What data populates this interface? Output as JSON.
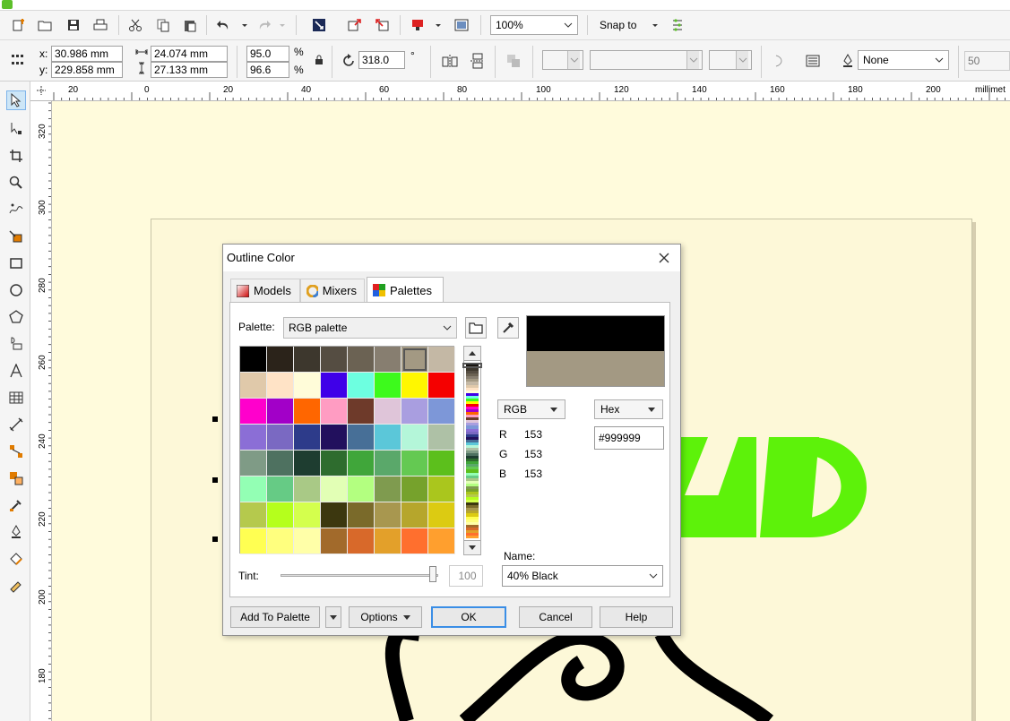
{
  "toolbar": {
    "zoom_value": "100%",
    "snap_label": "Snap to"
  },
  "props": {
    "x_label": "x:",
    "x_value": "30.986 mm",
    "y_label": "y:",
    "y_value": "229.858 mm",
    "width_value": "24.074 mm",
    "height_value": "27.133 mm",
    "scale_x": "95.0",
    "scale_y": "96.6",
    "percent": "%",
    "rotation": "318.0",
    "degree": "°",
    "outline_value": "None",
    "outline_width": "50"
  },
  "ruler": {
    "h_labels": [
      "20",
      "0",
      "20",
      "40",
      "60",
      "80",
      "100",
      "120",
      "140",
      "160",
      "180",
      "200",
      "millimet"
    ],
    "v_labels": [
      "320",
      "300",
      "280",
      "260",
      "240",
      "220",
      "200",
      "180"
    ]
  },
  "dialog": {
    "title": "Outline Color",
    "tabs": [
      "Models",
      "Mixers",
      "Palettes"
    ],
    "palette_label": "Palette:",
    "palette_value": "RGB palette",
    "model_value": "RGB",
    "format_value": "Hex",
    "hex_value": "#999999",
    "r_label": "R",
    "r_value": "153",
    "g_label": "G",
    "g_value": "153",
    "b_label": "B",
    "b_value": "153",
    "name_label": "Name:",
    "name_value": "40% Black",
    "tint_label": "Tint:",
    "tint_value": "100",
    "tint_level": 1.0,
    "buttons": {
      "add_to_palette": "Add To Palette",
      "options": "Options",
      "ok": "OK",
      "cancel": "Cancel",
      "help": "Help"
    },
    "preview_new_color": "#000000",
    "preview_old_color": "#a39983",
    "swatches": [
      "#000000",
      "#2b231a",
      "#3d372d",
      "#554d42",
      "#6b6253",
      "#877e70",
      "#a39983",
      "#c4b8a5",
      "#e0c9aa",
      "#ffe3c6",
      "#fffcd9",
      "#3f00e8",
      "#6dffe0",
      "#3dfa1c",
      "#fff700",
      "#f50000",
      "#ff00cc",
      "#a200c8",
      "#ff6600",
      "#ff9cc2",
      "#6e3a2a",
      "#dfc5d9",
      "#a99ee0",
      "#7d97d8",
      "#8b6ed6",
      "#7a69c2",
      "#2d3b8a",
      "#22105d",
      "#476f97",
      "#5bc7d9",
      "#b4f6d9",
      "#aec1a6",
      "#7f9b86",
      "#4e7160",
      "#1e3d30",
      "#2e6c2e",
      "#40a63a",
      "#5aa86a",
      "#64c952",
      "#5cbf1c",
      "#93ffb4",
      "#66cb85",
      "#a9c986",
      "#e2ffb5",
      "#b3ff80",
      "#7f9b4f",
      "#76a22c",
      "#aac61d",
      "#b5c94d",
      "#b5ff1c",
      "#d4ff4d",
      "#3c370f",
      "#7a6a2a",
      "#a8974f",
      "#b6a62c",
      "#dccb12",
      "#ffff52",
      "#ffff7e",
      "#ffffa8",
      "#a26a2b",
      "#d8692a",
      "#e3a02a",
      "#ff6f2e",
      "#ff9f2e"
    ]
  }
}
